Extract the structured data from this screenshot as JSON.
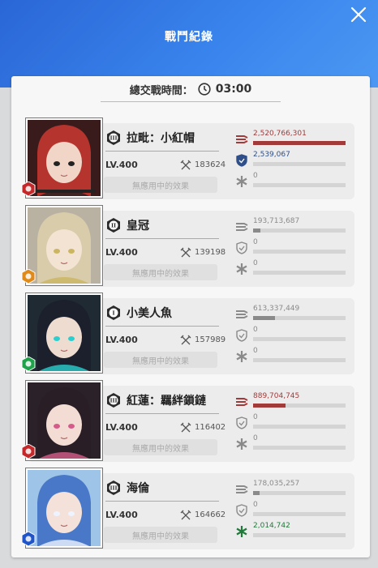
{
  "header": {
    "title": "戰鬥紀錄"
  },
  "summary": {
    "label": "總交戰時間：",
    "time": "03:00"
  },
  "effect_label": "無應用中的效果",
  "colors": {
    "header_blue": "#2f6fd8",
    "damage_red": "#a33a3a",
    "shield_blue": "#2f4f8a",
    "heal_green": "#1f7a3a",
    "neutral_gray": "#8a8a8a"
  },
  "characters": [
    {
      "name": "拉毗：小紅帽",
      "burst": "III",
      "level": "LV.400",
      "power": "183624",
      "element": "fire",
      "damage": "2,520,766,301",
      "damage_ratio": 1.0,
      "shield": "2,539,067",
      "shield_ratio": 0.0,
      "heal": "0",
      "heal_ratio": 0.0,
      "highlight": [
        "damage",
        "shield"
      ]
    },
    {
      "name": "皇冠",
      "burst": "II",
      "level": "LV.400",
      "power": "139198",
      "element": "iron",
      "damage": "193,713,687",
      "damage_ratio": 0.08,
      "shield": "0",
      "shield_ratio": 0.0,
      "heal": "0",
      "heal_ratio": 0.0,
      "highlight": []
    },
    {
      "name": "小美人魚",
      "burst": "I",
      "level": "LV.400",
      "power": "157989",
      "element": "wind",
      "damage": "613,337,449",
      "damage_ratio": 0.24,
      "shield": "0",
      "shield_ratio": 0.0,
      "heal": "0",
      "heal_ratio": 0.0,
      "highlight": []
    },
    {
      "name": "紅蓮：羈絆鎖鏈",
      "burst": "III",
      "level": "LV.400",
      "power": "116402",
      "element": "fire",
      "damage": "889,704,745",
      "damage_ratio": 0.35,
      "shield": "0",
      "shield_ratio": 0.0,
      "heal": "0",
      "heal_ratio": 0.0,
      "highlight": [
        "damage"
      ]
    },
    {
      "name": "海倫",
      "burst": "III",
      "level": "LV.400",
      "power": "164662",
      "element": "water",
      "damage": "178,035,257",
      "damage_ratio": 0.07,
      "shield": "0",
      "shield_ratio": 0.0,
      "heal": "2,014,742",
      "heal_ratio": 0.0,
      "highlight": [
        "heal"
      ]
    }
  ]
}
